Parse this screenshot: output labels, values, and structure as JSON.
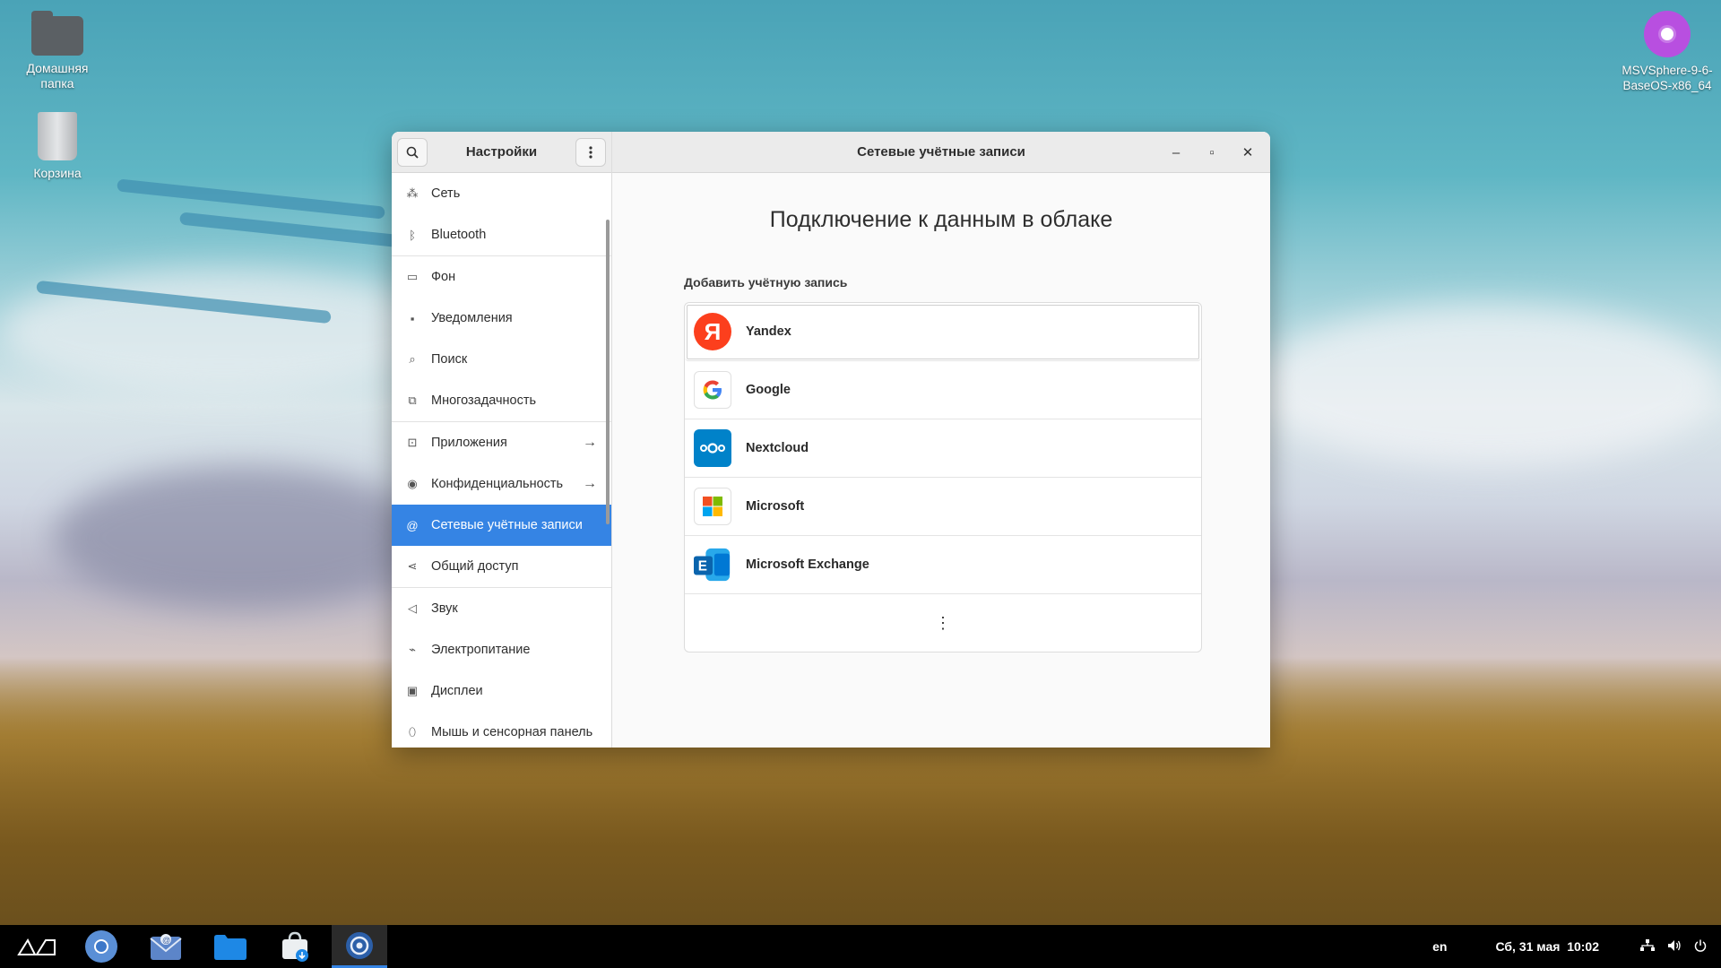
{
  "desktop": {
    "home_folder_label": "Домашняя папка",
    "trash_label": "Корзина",
    "disc_label": "MSVSphere-9-6-BaseOS-x86_64"
  },
  "window": {
    "sidebar_title": "Настройки",
    "main_title": "Сетевые учётные записи",
    "minimize": "–",
    "maximize": "▫",
    "close": "✕"
  },
  "sidebar": {
    "items": [
      {
        "label": "Сеть",
        "icon": "network-icon"
      },
      {
        "label": "Bluetooth",
        "icon": "bluetooth-icon"
      },
      {
        "label": "Фон",
        "icon": "background-icon"
      },
      {
        "label": "Уведомления",
        "icon": "notifications-icon"
      },
      {
        "label": "Поиск",
        "icon": "search-icon"
      },
      {
        "label": "Многозадачность",
        "icon": "multitasking-icon"
      },
      {
        "label": "Приложения",
        "icon": "apps-icon"
      },
      {
        "label": "Конфиденциальность",
        "icon": "privacy-icon"
      },
      {
        "label": "Сетевые учётные записи",
        "icon": "online-accounts-icon"
      },
      {
        "label": "Общий доступ",
        "icon": "sharing-icon"
      },
      {
        "label": "Звук",
        "icon": "sound-icon"
      },
      {
        "label": "Электропитание",
        "icon": "power-icon"
      },
      {
        "label": "Дисплеи",
        "icon": "displays-icon"
      },
      {
        "label": "Мышь и сенсорная панель",
        "icon": "mouse-icon"
      }
    ]
  },
  "main": {
    "headline": "Подключение к данным в облаке",
    "section_label": "Добавить учётную запись",
    "accounts": [
      {
        "label": "Yandex"
      },
      {
        "label": "Google"
      },
      {
        "label": "Nextcloud"
      },
      {
        "label": "Microsoft"
      },
      {
        "label": "Microsoft Exchange"
      }
    ],
    "more": "⋮"
  },
  "taskbar": {
    "lang": "en",
    "clock": "Сб, 31 мая  10:02"
  },
  "colors": {
    "accent": "#3584e4",
    "yandex": "#fc3f1d",
    "nextcloud": "#0082c9"
  }
}
